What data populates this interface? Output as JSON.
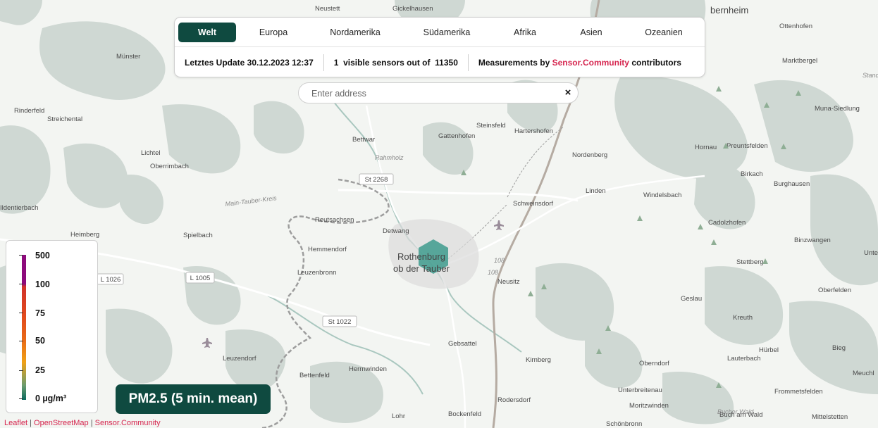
{
  "regions": {
    "tabs": [
      {
        "label": "Welt",
        "active": true
      },
      {
        "label": "Europa",
        "active": false
      },
      {
        "label": "Nordamerika",
        "active": false
      },
      {
        "label": "Südamerika",
        "active": false
      },
      {
        "label": "Afrika",
        "active": false
      },
      {
        "label": "Asien",
        "active": false
      },
      {
        "label": "Ozeanien",
        "active": false
      }
    ]
  },
  "info": {
    "last_update": "Letztes Update 30.12.2023 12:37",
    "visible_count": "1",
    "visible_text": "visible sensors out of",
    "total_count": "11350",
    "measurements_prefix": "Measurements by",
    "measurements_link": "Sensor.Community",
    "measurements_suffix": "contributors"
  },
  "search": {
    "placeholder": "Enter address",
    "clear_label": "×"
  },
  "legend": {
    "labels": [
      "500",
      "100",
      "75",
      "50",
      "25",
      "0 µg/m³"
    ]
  },
  "pm_badge": {
    "label": "PM2.5 (5 min. mean)"
  },
  "attribution": {
    "leaflet": "Leaflet",
    "sep1": " | ",
    "osm": "OpenStreetMap",
    "sep2": " | ",
    "sc": "Sensor.Community"
  },
  "map": {
    "center_label_line1": "Rothenburg",
    "center_label_line2": "ob der Tauber",
    "sensor_color": "#3e9b8d",
    "places": [
      {
        "name": "Neustett"
      },
      {
        "name": "Gickelhausen"
      },
      {
        "name": "Münster"
      },
      {
        "name": "Streichental"
      },
      {
        "name": "Rinderfeld"
      },
      {
        "name": "Lichtel"
      },
      {
        "name": "Oberrimbach"
      },
      {
        "name": "Bettwar"
      },
      {
        "name": "Gattenhofen"
      },
      {
        "name": "Steinsfeld"
      },
      {
        "name": "Hartershofen"
      },
      {
        "name": "Nordenberg"
      },
      {
        "name": "Hornau"
      },
      {
        "name": "Preuntsfelden"
      },
      {
        "name": "Birkach"
      },
      {
        "name": "Burghausen"
      },
      {
        "name": "Ottenhofen"
      },
      {
        "name": "Marktbergel"
      },
      {
        "name": "Muna-Siedlung"
      },
      {
        "name": "Linden"
      },
      {
        "name": "Windelsbach"
      },
      {
        "name": "Schweinsdorf"
      },
      {
        "name": "Reutsachsen"
      },
      {
        "name": "Detwang"
      },
      {
        "name": "Hemmendorf"
      },
      {
        "name": "Heimberg"
      },
      {
        "name": "Spielbach"
      },
      {
        "name": "Leuzenbronn"
      },
      {
        "name": "Cadolzhofen"
      },
      {
        "name": "Binzwangen"
      },
      {
        "name": "Stettberg"
      },
      {
        "name": "Neusitz"
      },
      {
        "name": "Geslau"
      },
      {
        "name": "Oberfelden"
      },
      {
        "name": "Kreuth"
      },
      {
        "name": "Gebsattel"
      },
      {
        "name": "Hürbel"
      },
      {
        "name": "Bieg"
      },
      {
        "name": "Lauterbach"
      },
      {
        "name": "Leuzendorf"
      },
      {
        "name": "Herrnwinden"
      },
      {
        "name": "Kirnberg"
      },
      {
        "name": "Oberndorf"
      },
      {
        "name": "Bettenfeld"
      },
      {
        "name": "Unterbreitenau"
      },
      {
        "name": "Frommetsfelden"
      },
      {
        "name": "Moritzwinden"
      },
      {
        "name": "Buch am Wald"
      },
      {
        "name": "Rodersdorf"
      },
      {
        "name": "Bockenfeld"
      },
      {
        "name": "Lohr"
      },
      {
        "name": "Schönbronn"
      },
      {
        "name": "Meuchl"
      },
      {
        "name": "Mittelstetten"
      },
      {
        "name": "Ildentierbach"
      },
      {
        "name": "bernheim"
      },
      {
        "name": "Unte"
      }
    ],
    "roads": [
      "St 2268",
      "L 1026",
      "L 1005",
      "St 1022",
      "108",
      "108"
    ],
    "italic_labels": [
      "Rahmholz",
      "Main-Tauber-Kreis",
      "Stand",
      "Bucher Wald"
    ]
  }
}
